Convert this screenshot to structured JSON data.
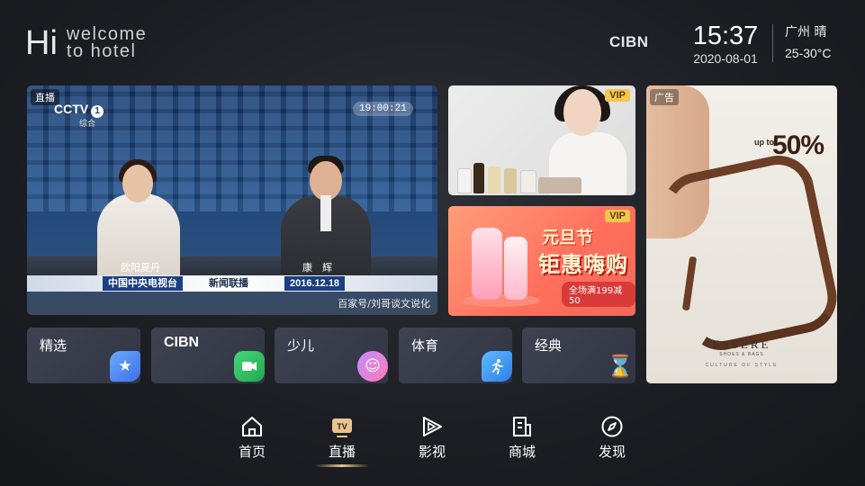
{
  "header": {
    "greeting_hi": "Hi",
    "greeting_line1": "welcome",
    "greeting_line2": "to hotel",
    "brand": "CIBN",
    "time": "15:37",
    "date": "2020-08-01",
    "city_weather": "广州 晴",
    "temperature": "25-30°C"
  },
  "live_card": {
    "tag": "直播",
    "channel_logo": "CCTV",
    "channel_number": "1",
    "channel_sub": "综合",
    "clock_badge": "19:00:21",
    "anchor_left_name": "欧阳夏丹",
    "anchor_right_name": "康　辉",
    "bar_left": "中国中央电视台",
    "bar_center": "新闻联播",
    "bar_right": "2016.12.18",
    "watermark": "百家号/刘哥谈文说化"
  },
  "ad_cards": {
    "vip_badge_1": "VIP",
    "vip_badge_2": "VIP",
    "promo_title": "元旦节",
    "promo_main": "钜惠嗨购",
    "promo_sub": "全场满199减50",
    "tall_badge": "广告",
    "sale_up": "up to",
    "sale_pct": "50%",
    "brand": "ESSERE",
    "brand_sub": "SHOES & BAGS",
    "brand_culture": "CULTURE OF STYLE"
  },
  "tiles": [
    {
      "label": "精选",
      "icon": "star-icon",
      "color": "#4f8cf5"
    },
    {
      "label": "CIBN",
      "icon": "video-camera-icon",
      "color": "#2fc25b"
    },
    {
      "label": "少儿",
      "icon": "kids-icon",
      "color": "#a56cf0"
    },
    {
      "label": "体育",
      "icon": "running-icon",
      "color": "#3a9cf5"
    },
    {
      "label": "经典",
      "icon": "hourglass-icon",
      "color": "#f08b3a"
    }
  ],
  "nav": {
    "items": [
      {
        "label": "首页",
        "icon": "home-icon"
      },
      {
        "label": "直播",
        "icon": "tv-icon",
        "active": true
      },
      {
        "label": "影视",
        "icon": "play-icon"
      },
      {
        "label": "商城",
        "icon": "shop-icon"
      },
      {
        "label": "发现",
        "icon": "compass-icon"
      }
    ],
    "tv_icon_text": "TV",
    "active_color": "#e9c48c"
  }
}
